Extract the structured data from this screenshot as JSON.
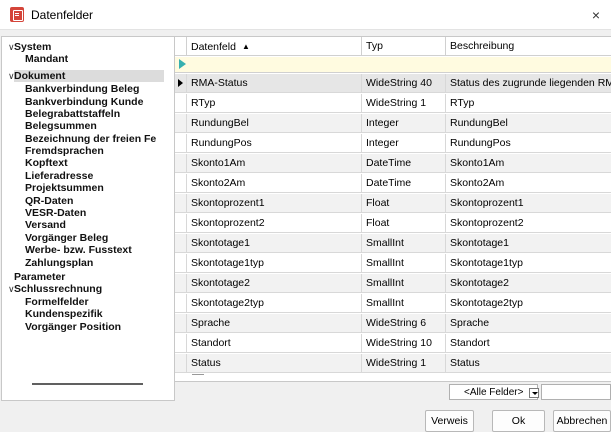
{
  "window": {
    "title": "Datenfelder",
    "close_glyph": "×"
  },
  "tree": {
    "items": [
      {
        "label": "System",
        "level": 0,
        "expanded": true
      },
      {
        "label": "Mandant",
        "level": 1
      },
      {
        "label": "Dokument",
        "level": 0,
        "expanded": true,
        "selected": true
      },
      {
        "label": "Bankverbindung Beleg",
        "level": 1
      },
      {
        "label": "Bankverbindung Kunde",
        "level": 1
      },
      {
        "label": "Belegrabattstaffeln",
        "level": 1
      },
      {
        "label": "Belegsummen",
        "level": 1
      },
      {
        "label": "Bezeichnung der freien Fe",
        "level": 1
      },
      {
        "label": "Fremdsprachen",
        "level": 1
      },
      {
        "label": "Kopftext",
        "level": 1
      },
      {
        "label": "Lieferadresse",
        "level": 1
      },
      {
        "label": "Projektsummen",
        "level": 1
      },
      {
        "label": "QR-Daten",
        "level": 1
      },
      {
        "label": "VESR-Daten",
        "level": 1
      },
      {
        "label": "Versand",
        "level": 1
      },
      {
        "label": "Vorgänger Beleg",
        "level": 1
      },
      {
        "label": "Werbe- bzw. Fusstext",
        "level": 1
      },
      {
        "label": "Zahlungsplan",
        "level": 1
      },
      {
        "label": "Parameter",
        "level": 0
      },
      {
        "label": "Schlussrechnung",
        "level": 0,
        "expanded": true
      },
      {
        "label": "Formelfelder",
        "level": 1
      },
      {
        "label": "Kundenspezifik",
        "level": 1
      },
      {
        "label": "Vorgänger Position",
        "level": 1
      }
    ]
  },
  "grid": {
    "columns": [
      "Datenfeld",
      "Typ",
      "Beschreibung"
    ],
    "sort_glyph": "▲",
    "rows": [
      {
        "field": "RMA-Status",
        "type": "WideString  40",
        "desc": "Status des zugrunde liegenden RMA-Vorga"
      },
      {
        "field": "RTyp",
        "type": "WideString  1",
        "desc": "RTyp"
      },
      {
        "field": "RundungBel",
        "type": "Integer",
        "desc": "RundungBel"
      },
      {
        "field": "RundungPos",
        "type": "Integer",
        "desc": "RundungPos"
      },
      {
        "field": "Skonto1Am",
        "type": "DateTime",
        "desc": "Skonto1Am"
      },
      {
        "field": "Skonto2Am",
        "type": "DateTime",
        "desc": "Skonto2Am"
      },
      {
        "field": "Skontoprozent1",
        "type": "Float",
        "desc": "Skontoprozent1"
      },
      {
        "field": "Skontoprozent2",
        "type": "Float",
        "desc": "Skontoprozent2"
      },
      {
        "field": "Skontotage1",
        "type": "SmallInt",
        "desc": "Skontotage1"
      },
      {
        "field": "Skontotage1typ",
        "type": "SmallInt",
        "desc": "Skontotage1typ"
      },
      {
        "field": "Skontotage2",
        "type": "SmallInt",
        "desc": "Skontotage2"
      },
      {
        "field": "Skontotage2typ",
        "type": "SmallInt",
        "desc": "Skontotage2typ"
      },
      {
        "field": "Sprache",
        "type": "WideString  6",
        "desc": "Sprache"
      },
      {
        "field": "Standort",
        "type": "WideString  10",
        "desc": "Standort"
      },
      {
        "field": "Status",
        "type": "WideString  1",
        "desc": "Status"
      }
    ]
  },
  "filter": {
    "selected": "<Alle Felder>",
    "text": ""
  },
  "buttons": {
    "verweis": "Verweis",
    "ok": "Ok",
    "cancel": "Abbrechen"
  },
  "colors": {
    "filter_row": "#fffbe0",
    "filter_marker": "#36b0b0",
    "icon": "#d4453a"
  }
}
